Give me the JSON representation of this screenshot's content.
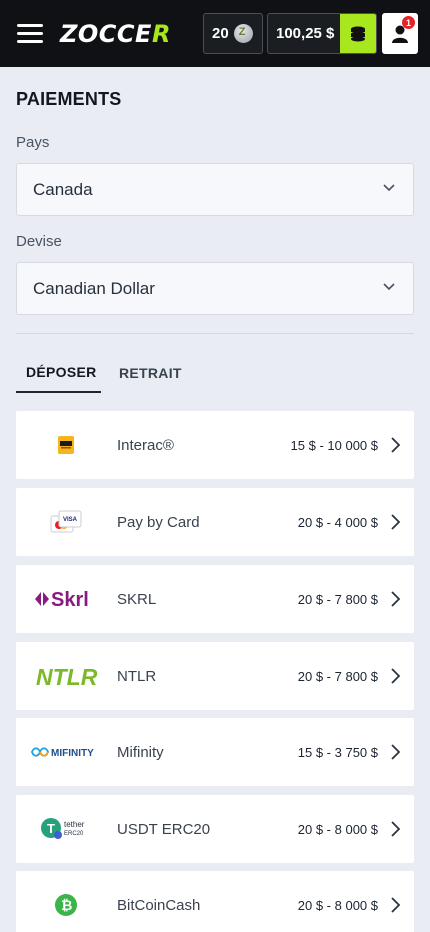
{
  "header": {
    "logo_text": "ZOCCE",
    "logo_accent": "R",
    "coins": "20",
    "balance": "100,25 $",
    "notifications": "1"
  },
  "page": {
    "title": "PAIEMENTS",
    "country_label": "Pays",
    "country_value": "Canada",
    "currency_label": "Devise",
    "currency_value": "Canadian Dollar"
  },
  "tabs": [
    {
      "label": "DÉPOSER",
      "active": true
    },
    {
      "label": "RETRAIT",
      "active": false
    }
  ],
  "methods": [
    {
      "name": "Interac®",
      "range": "15 $ - 10 000 $",
      "icon": "interac-logo"
    },
    {
      "name": "Pay by Card",
      "range": "20 $ - 4 000 $",
      "icon": "card-logo"
    },
    {
      "name": "SKRL",
      "range": "20 $ - 7 800 $",
      "icon": "skrill-logo",
      "logo_text": "Skrl"
    },
    {
      "name": "NTLR",
      "range": "20 $ - 7 800 $",
      "icon": "neteller-logo",
      "logo_text": "NTLR"
    },
    {
      "name": "Mifinity",
      "range": "15 $ - 3 750 $",
      "icon": "mifinity-logo",
      "logo_text": "MIFINITY"
    },
    {
      "name": "USDT ERC20",
      "range": "20 $ - 8 000 $",
      "icon": "tether-logo",
      "logo_text": "tether",
      "logo_sub": "ERC20"
    },
    {
      "name": "BitCoinCash",
      "range": "20 $ - 8 000 $",
      "icon": "bitcoincash-logo"
    }
  ],
  "colors": {
    "accent": "#a8e61d",
    "header_bg": "#0f1114",
    "page_bg": "#e9edf3",
    "notification": "#e0242a"
  }
}
